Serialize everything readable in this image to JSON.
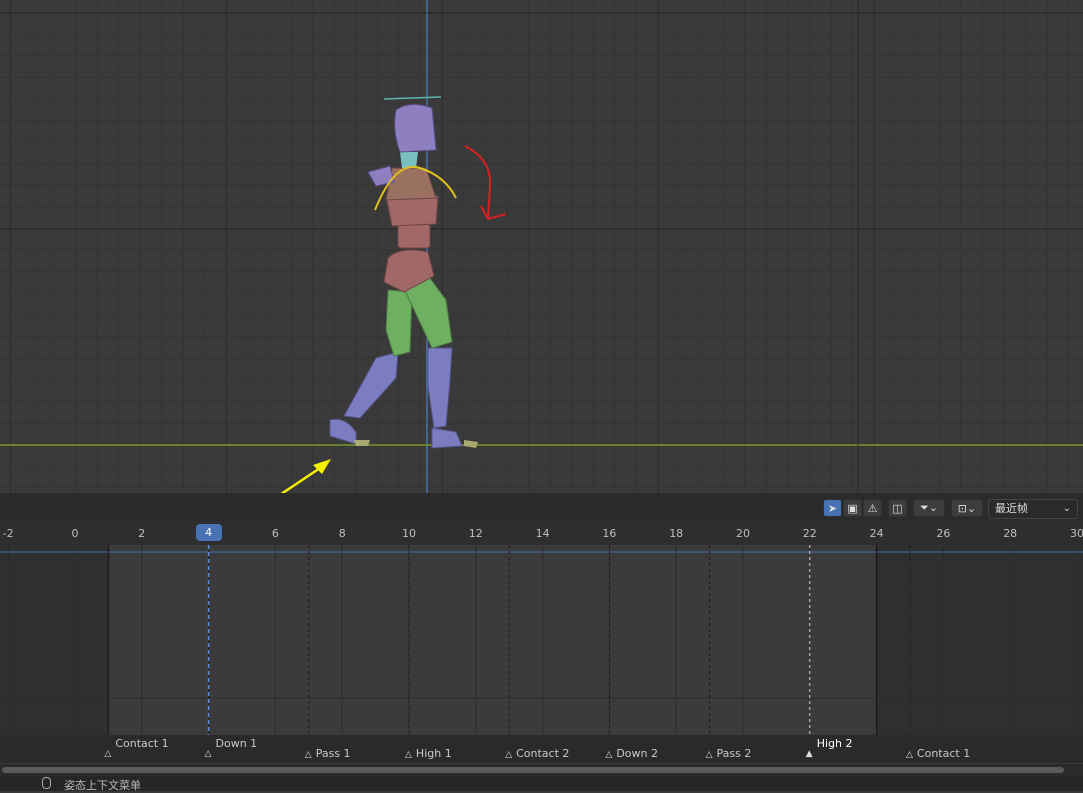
{
  "timeline": {
    "frame_ticks": [
      "-2",
      "0",
      "2",
      "4",
      "6",
      "8",
      "10",
      "12",
      "14",
      "16",
      "18",
      "20",
      "22",
      "24",
      "26",
      "28",
      "30"
    ],
    "current_frame": "4",
    "mode_select": "最近帧",
    "markers": [
      {
        "label": "Contact 1",
        "frame": 1,
        "row": "upper",
        "selected": false
      },
      {
        "label": "Down 1",
        "frame": 4,
        "row": "upper",
        "selected": false
      },
      {
        "label": "Pass 1",
        "frame": 7,
        "row": "lower",
        "selected": false
      },
      {
        "label": "High 1",
        "frame": 10,
        "row": "lower",
        "selected": false
      },
      {
        "label": "Contact 2",
        "frame": 13,
        "row": "lower",
        "selected": false
      },
      {
        "label": "Down 2",
        "frame": 16,
        "row": "lower",
        "selected": false
      },
      {
        "label": "Pass 2",
        "frame": 19,
        "row": "lower",
        "selected": false
      },
      {
        "label": "High 2",
        "frame": 22,
        "row": "upper",
        "selected": true
      },
      {
        "label": "Contact 1",
        "frame": 25,
        "row": "lower",
        "selected": false
      }
    ],
    "frame_range": {
      "start": 1,
      "end": 24
    }
  },
  "statusbar": {
    "text": "姿态上下文菜单"
  },
  "colors": {
    "accent": "#4772b3",
    "arrow": "#f5f000",
    "annotation": "#d92020",
    "torso": "#a26868",
    "limb_upper": "#6faf62",
    "limb_lower": "#7c7cc0",
    "head": "#8d7fc0"
  },
  "icons": {
    "select": "cursor-arrow-icon",
    "box": "box-select-icon",
    "warning": "warning-icon",
    "filter": "funnel-icon",
    "snap": "snap-icon"
  }
}
